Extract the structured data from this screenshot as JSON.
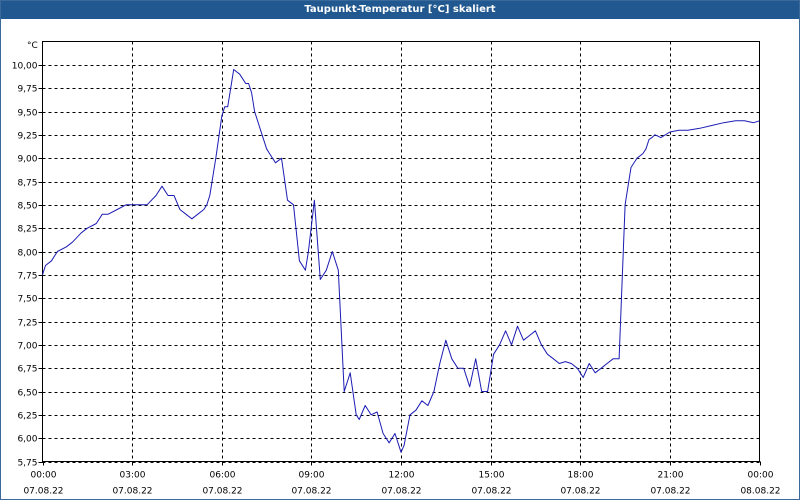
{
  "window": {
    "title": "Taupunkt-Temperatur [°C] skaliert"
  },
  "colors": {
    "titlebar": "#21588f",
    "line": "#1c1cb4",
    "grid": "#000000"
  },
  "chart_data": {
    "type": "line",
    "title": "Taupunkt-Temperatur [°C] skaliert",
    "ylabel": "°C",
    "xlabel": "",
    "ylim": [
      5.75,
      10.25
    ],
    "xlim": [
      0,
      24
    ],
    "grid": true,
    "y_ticks": [
      "5,75",
      "6,00",
      "6,25",
      "6,50",
      "6,75",
      "7,00",
      "7,25",
      "7,50",
      "7,75",
      "8,00",
      "8,25",
      "8,50",
      "8,75",
      "9,00",
      "9,25",
      "9,50",
      "9,75",
      "10,00"
    ],
    "y_tick_values": [
      5.75,
      6.0,
      6.25,
      6.5,
      6.75,
      7.0,
      7.25,
      7.5,
      7.75,
      8.0,
      8.25,
      8.5,
      8.75,
      9.0,
      9.25,
      9.5,
      9.75,
      10.0
    ],
    "x_ticks": [
      {
        "time": "00:00",
        "date": "07.08.22"
      },
      {
        "time": "03:00",
        "date": "07.08.22"
      },
      {
        "time": "06:00",
        "date": "07.08.22"
      },
      {
        "time": "09:00",
        "date": "07.08.22"
      },
      {
        "time": "12:00",
        "date": "07.08.22"
      },
      {
        "time": "15:00",
        "date": "07.08.22"
      },
      {
        "time": "18:00",
        "date": "07.08.22"
      },
      {
        "time": "21:00",
        "date": "07.08.22"
      },
      {
        "time": "00:00",
        "date": "08.08.22"
      }
    ],
    "x_tick_values": [
      0,
      3,
      6,
      9,
      12,
      15,
      18,
      21,
      24
    ],
    "series": [
      {
        "x": [
          0.0,
          0.1,
          0.3,
          0.5,
          0.8,
          1.0,
          1.3,
          1.5,
          1.8,
          2.0,
          2.2,
          2.5,
          2.8,
          3.0,
          3.2,
          3.5,
          3.8,
          4.0,
          4.2,
          4.4,
          4.6,
          4.8,
          5.0,
          5.2,
          5.4,
          5.5,
          5.6,
          5.8,
          6.0,
          6.1,
          6.2,
          6.4,
          6.6,
          6.7,
          6.8,
          6.9,
          7.0,
          7.1,
          7.3,
          7.5,
          7.6,
          7.8,
          8.0,
          8.2,
          8.4,
          8.6,
          8.8,
          8.9,
          9.1,
          9.3,
          9.5,
          9.7,
          9.9,
          10.1,
          10.3,
          10.5,
          10.6,
          10.8,
          11.0,
          11.2,
          11.4,
          11.6,
          11.8,
          12.0,
          12.1,
          12.3,
          12.5,
          12.7,
          12.9,
          13.1,
          13.3,
          13.5,
          13.7,
          13.9,
          14.1,
          14.3,
          14.5,
          14.7,
          14.9,
          15.1,
          15.3,
          15.5,
          15.7,
          15.9,
          16.1,
          16.3,
          16.5,
          16.7,
          16.9,
          17.1,
          17.3,
          17.5,
          17.7,
          17.9,
          18.1,
          18.3,
          18.5,
          18.7,
          18.9,
          19.1,
          19.3,
          19.5,
          19.7,
          19.9,
          20.1,
          20.2,
          20.3,
          20.4,
          20.5,
          20.7,
          21.0,
          21.3,
          21.6,
          22.0,
          22.4,
          22.8,
          23.2,
          23.5,
          23.8,
          24.0
        ],
        "y": [
          7.75,
          7.85,
          7.9,
          8.0,
          8.05,
          8.1,
          8.2,
          8.25,
          8.3,
          8.4,
          8.4,
          8.45,
          8.5,
          8.5,
          8.5,
          8.5,
          8.6,
          8.7,
          8.6,
          8.6,
          8.45,
          8.4,
          8.35,
          8.4,
          8.45,
          8.5,
          8.6,
          9.0,
          9.45,
          9.55,
          9.55,
          9.95,
          9.9,
          9.85,
          9.8,
          9.8,
          9.7,
          9.5,
          9.3,
          9.1,
          9.05,
          8.95,
          9.0,
          8.55,
          8.5,
          7.9,
          7.8,
          8.0,
          8.55,
          7.7,
          7.8,
          8.0,
          7.8,
          6.5,
          6.7,
          6.25,
          6.2,
          6.35,
          6.25,
          6.28,
          6.05,
          5.95,
          6.05,
          5.85,
          5.92,
          6.25,
          6.3,
          6.4,
          6.35,
          6.5,
          6.8,
          7.05,
          6.85,
          6.75,
          6.75,
          6.55,
          6.85,
          6.5,
          6.5,
          6.9,
          7.0,
          7.15,
          7.0,
          7.2,
          7.05,
          7.1,
          7.15,
          7.0,
          6.9,
          6.85,
          6.8,
          6.82,
          6.8,
          6.75,
          6.65,
          6.8,
          6.7,
          6.75,
          6.8,
          6.85,
          6.85,
          8.5,
          8.9,
          9.0,
          9.05,
          9.1,
          9.2,
          9.22,
          9.25,
          9.22,
          9.28,
          9.3,
          9.3,
          9.32,
          9.35,
          9.38,
          9.4,
          9.4,
          9.38,
          9.4
        ]
      }
    ]
  }
}
